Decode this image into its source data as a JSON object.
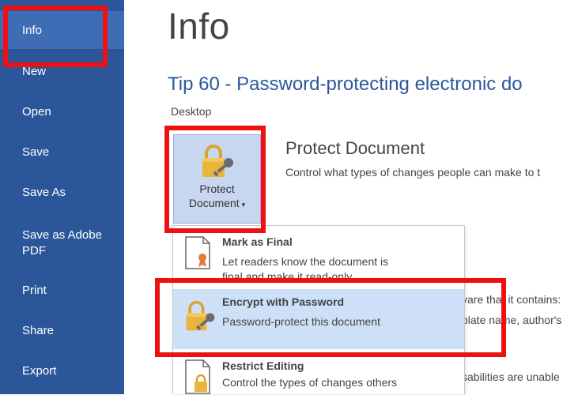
{
  "sidebar": {
    "items": [
      {
        "label": "Info"
      },
      {
        "label": "New"
      },
      {
        "label": "Open"
      },
      {
        "label": "Save"
      },
      {
        "label": "Save As"
      },
      {
        "label": "Save as Adobe PDF"
      },
      {
        "label": "Print"
      },
      {
        "label": "Share"
      },
      {
        "label": "Export"
      }
    ]
  },
  "main": {
    "page_title": "Info",
    "doc_title": "Tip 60 - Password-protecting electronic do",
    "location": "Desktop",
    "protect": {
      "button_line1": "Protect",
      "button_line2": "Document",
      "caret": "▾",
      "heading": "Protect Document",
      "description": "Control what types of changes people can make to t"
    },
    "background_text": [
      "vare that it contains:",
      "plate name, author's",
      "sabilities are unable"
    ]
  },
  "menu": {
    "items": [
      {
        "title": "Mark as Final",
        "desc_line1": "Let readers know the document is",
        "desc_line2": "final and make it read-only."
      },
      {
        "title": "Encrypt with Password",
        "desc_line1": "Password-protect this document"
      },
      {
        "title": "Restrict Editing",
        "desc_line1": "Control the types of changes others"
      }
    ]
  },
  "colors": {
    "sidebar": "#2b579a",
    "sidebar_active": "#3e6db5",
    "accent_title": "#2b579a",
    "menu_hover": "#cde0f7",
    "annotation": "#ee1111"
  },
  "icons": [
    "lock-key-icon",
    "ribbon-document-icon",
    "lock-document-icon"
  ]
}
